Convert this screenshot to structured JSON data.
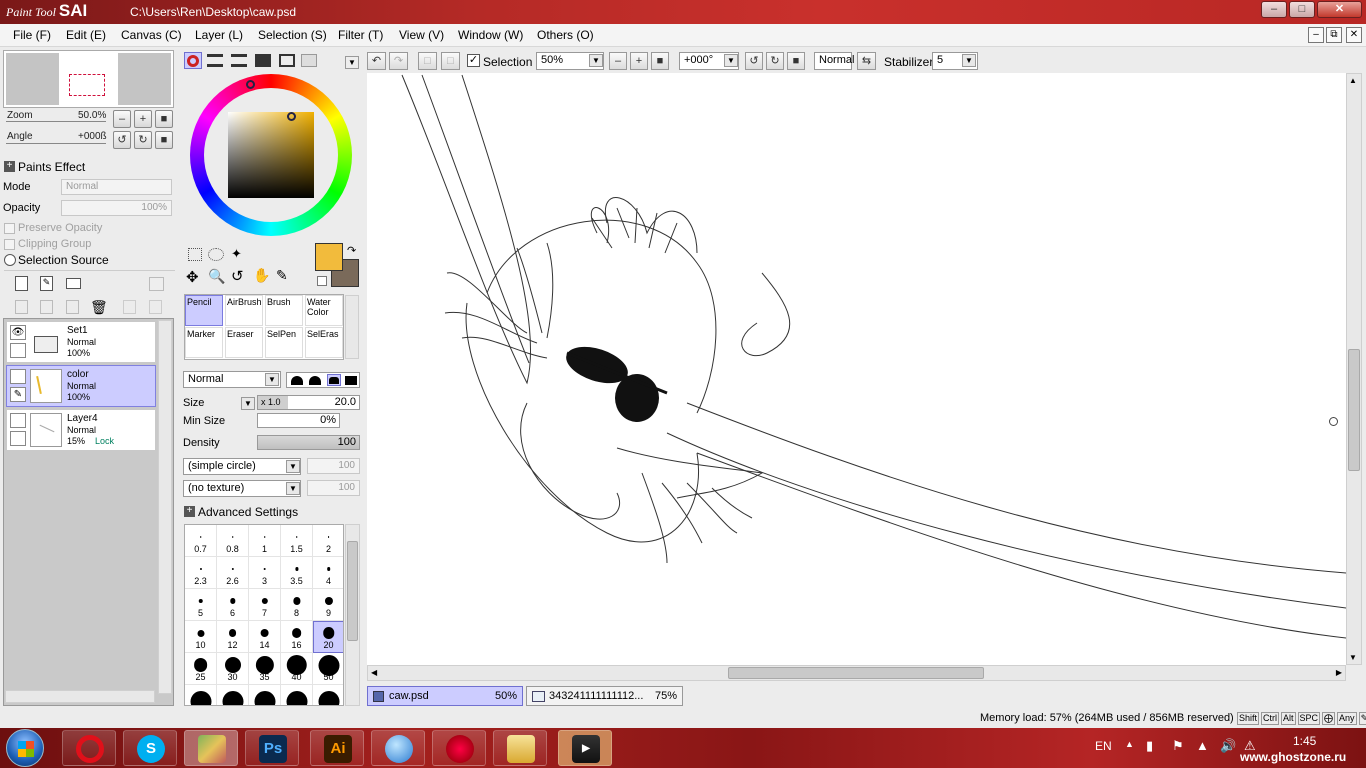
{
  "window": {
    "app_name_prefix": "Paint Tool",
    "app_name": "SAI",
    "file_path": "C:\\Users\\Ren\\Desktop\\caw.psd"
  },
  "menu": [
    {
      "label": "File (F)"
    },
    {
      "label": "Edit (E)"
    },
    {
      "label": "Canvas (C)"
    },
    {
      "label": "Layer (L)"
    },
    {
      "label": "Selection (S)"
    },
    {
      "label": "Filter (T)"
    },
    {
      "label": "View (V)"
    },
    {
      "label": "Window (W)"
    },
    {
      "label": "Others (O)"
    }
  ],
  "navigator": {
    "zoom_label": "Zoom",
    "zoom_value": "50.0%",
    "angle_label": "Angle",
    "angle_value": "+000ß"
  },
  "layer_props": {
    "paints_effect": "Paints Effect",
    "mode_label": "Mode",
    "mode_value": "Normal",
    "opacity_label": "Opacity",
    "opacity_value": "100%",
    "preserve_opacity": "Preserve Opacity",
    "clipping_group": "Clipping Group",
    "selection_source": "Selection Source"
  },
  "layers": [
    {
      "name": "Set1",
      "mode": "Normal",
      "opacity": "100%",
      "lock": "",
      "selected": false
    },
    {
      "name": "color",
      "mode": "Normal",
      "opacity": "100%",
      "lock": "",
      "selected": true
    },
    {
      "name": "Layer4",
      "mode": "Normal",
      "opacity": "15%",
      "lock": "Lock",
      "selected": false
    }
  ],
  "colors": {
    "primary": "#f2bb3c",
    "secondary": "#7a6a5a",
    "accent": "#ccccff"
  },
  "tools": [
    {
      "name": "Pencil",
      "line2": ""
    },
    {
      "name": "AirBrush",
      "line2": ""
    },
    {
      "name": "Brush",
      "line2": ""
    },
    {
      "name": "Water",
      "line2": "Color"
    },
    {
      "name": "Marker",
      "line2": ""
    },
    {
      "name": "Eraser",
      "line2": ""
    },
    {
      "name": "SelPen",
      "line2": ""
    },
    {
      "name": "SelEras",
      "line2": ""
    }
  ],
  "brush": {
    "blend_mode": "Normal",
    "size_label": "Size",
    "size_mult": "x 1.0",
    "size_value": "20.0",
    "minsize_label": "Min Size",
    "minsize_value": "0%",
    "density_label": "Density",
    "density_value": "100",
    "shape": "(simple circle)",
    "shape_value": "100",
    "texture": "(no texture)",
    "texture_value": "100",
    "advanced": "Advanced Settings"
  },
  "brush_sizes": [
    "0.7",
    "0.8",
    "1",
    "1.5",
    "2",
    "2.3",
    "2.6",
    "3",
    "3.5",
    "4",
    "5",
    "6",
    "7",
    "8",
    "9",
    "10",
    "12",
    "14",
    "16",
    "20",
    "25",
    "30",
    "35",
    "40",
    "50",
    "",
    "",
    "",
    "",
    ""
  ],
  "selected_brush_size": "20",
  "toolbar": {
    "selection_label": "Selection",
    "zoom": "50%",
    "angle": "+000°",
    "blend": "Normal",
    "stabilizer_label": "Stabilizer",
    "stabilizer_value": "5"
  },
  "tabs": [
    {
      "name": "caw.psd",
      "zoom": "50%"
    },
    {
      "name": "343241111111112...",
      "zoom": "75%"
    }
  ],
  "status": {
    "memory": "Memory load: 57% (264MB used / 856MB reserved)",
    "keys": [
      "Shift",
      "Ctrl",
      "Alt",
      "SPC",
      "Any"
    ]
  },
  "taskbar": {
    "apps": [
      {
        "name": "opera-icon"
      },
      {
        "name": "skype-icon",
        "label": "S"
      },
      {
        "name": "sai-icon"
      },
      {
        "name": "photoshop-icon",
        "label": "Ps"
      },
      {
        "name": "illustrator-icon",
        "label": "Ai"
      },
      {
        "name": "browser-icon"
      },
      {
        "name": "ccleaner-icon"
      },
      {
        "name": "explorer-icon"
      },
      {
        "name": "media-player-icon"
      }
    ],
    "lang": "EN",
    "time": "1:45",
    "watermark": "www.ghostzone.ru"
  }
}
